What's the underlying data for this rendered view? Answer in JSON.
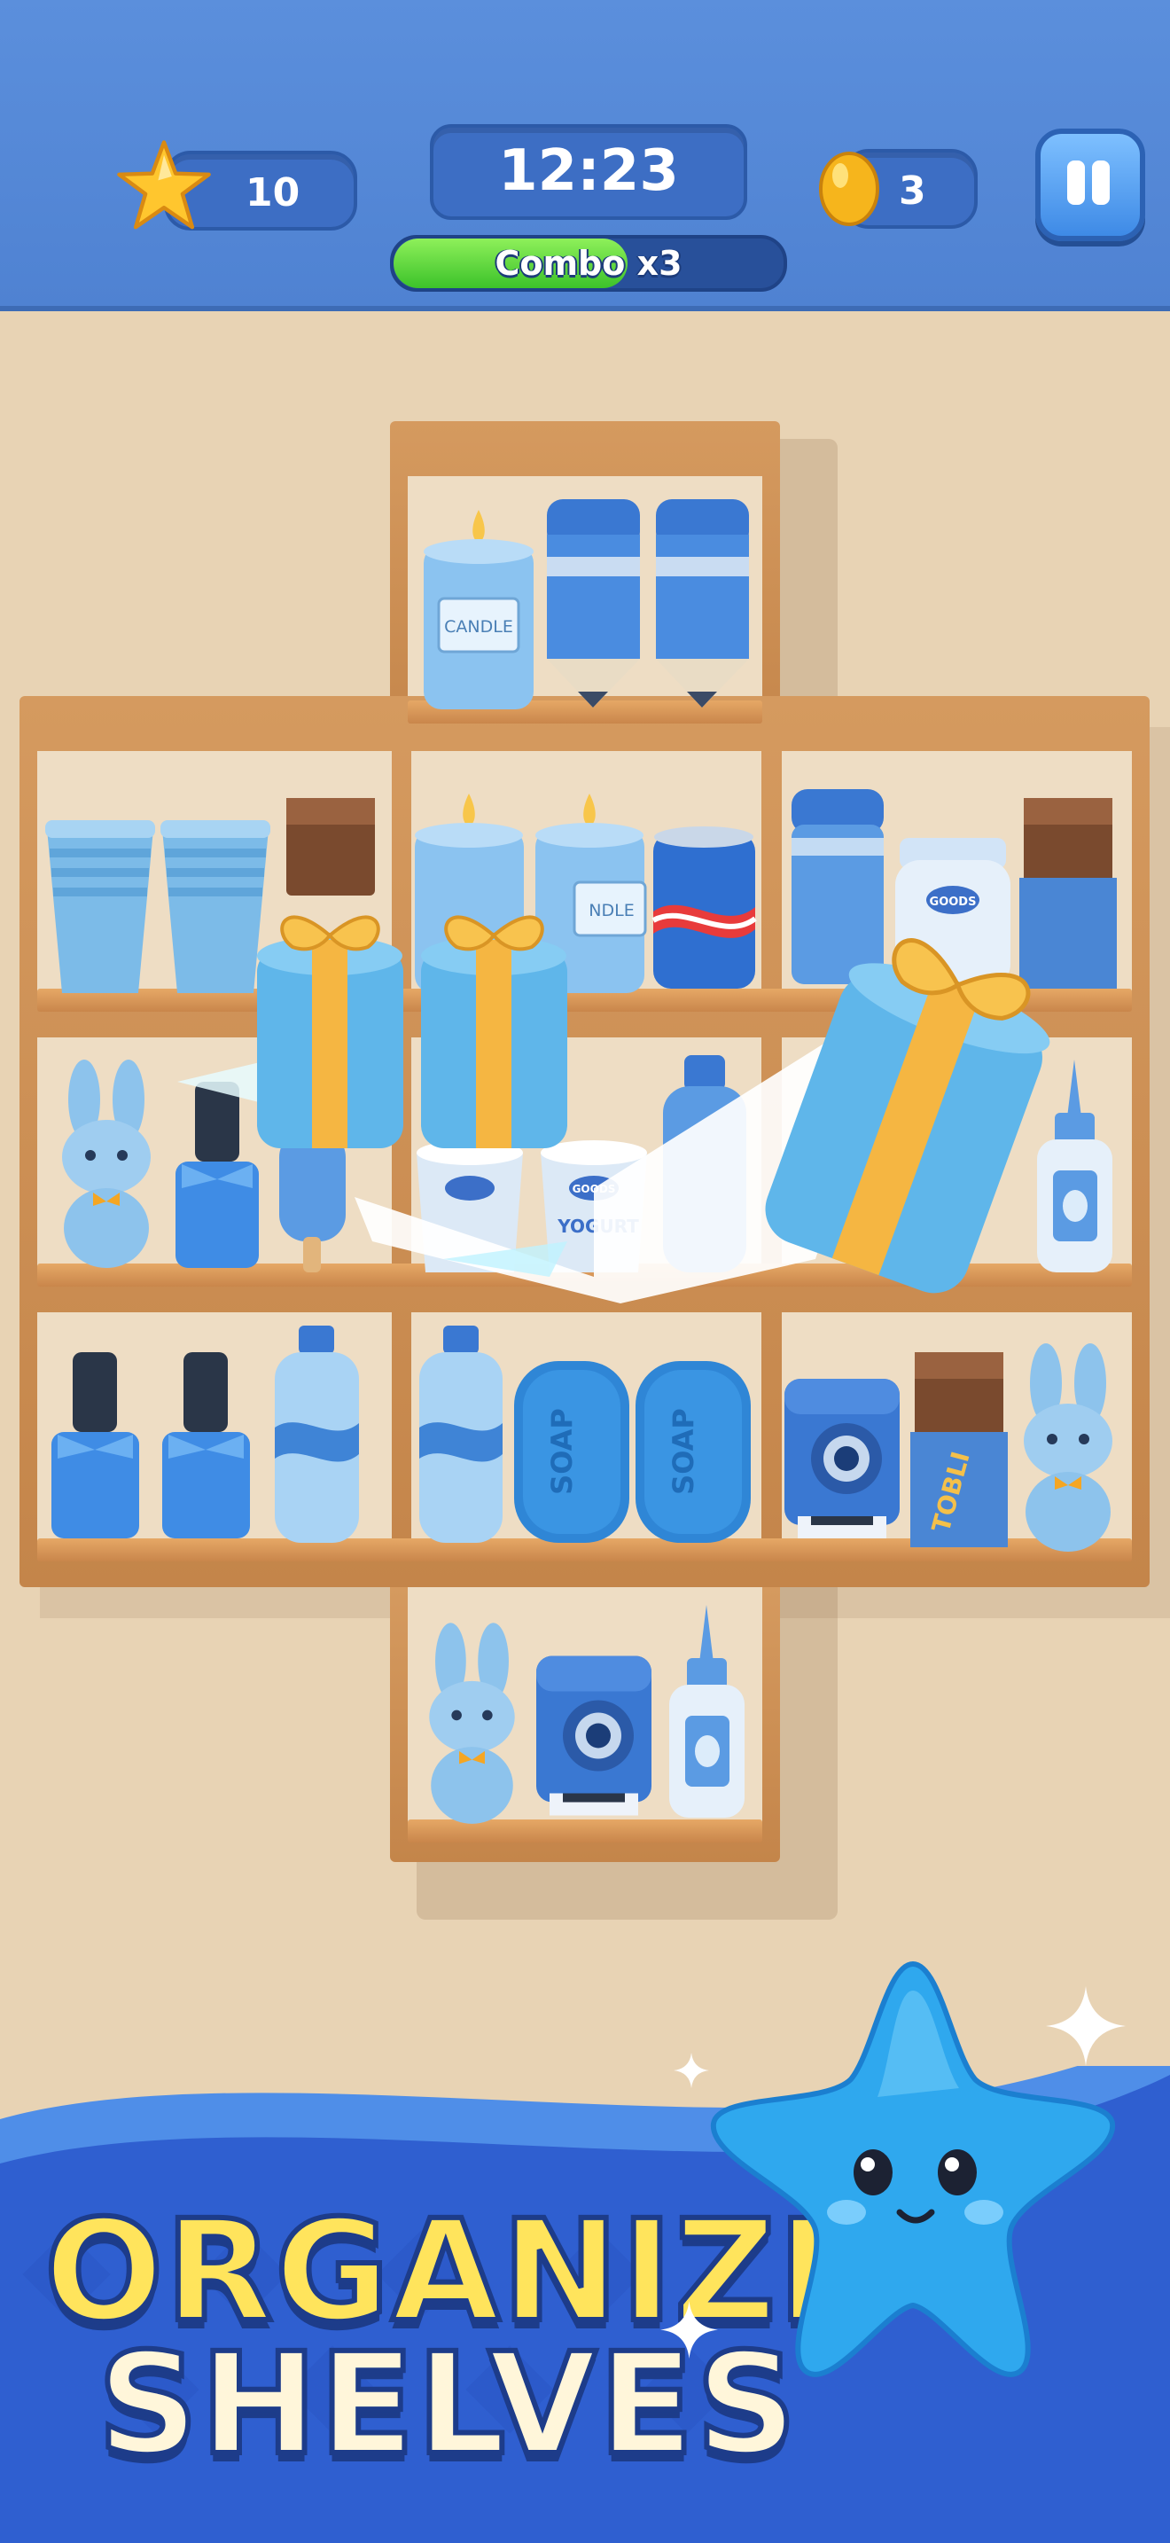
{
  "hud": {
    "stars": "10",
    "timer": "12:23",
    "combo_label": "Combo x3",
    "combo_progress": 0.6,
    "eggs": "3"
  },
  "item_labels": {
    "candle": "CANDLE",
    "candle_partial": "NDLE",
    "goods": "GOODS",
    "yogurt": "YOGURT",
    "soap": "SOAP",
    "tobli": "TOBLI"
  },
  "banner": {
    "line1": "ORGANIZE",
    "line2": "SHELVES"
  },
  "colors": {
    "hud_blue": "#5b8fdc",
    "item_blue": "#4a90d9",
    "gift_ribbon": "#f5b642",
    "banner_yellow": "#ffe45c",
    "banner_cream": "#fff6da",
    "banner_blue": "#2f5fd0"
  }
}
